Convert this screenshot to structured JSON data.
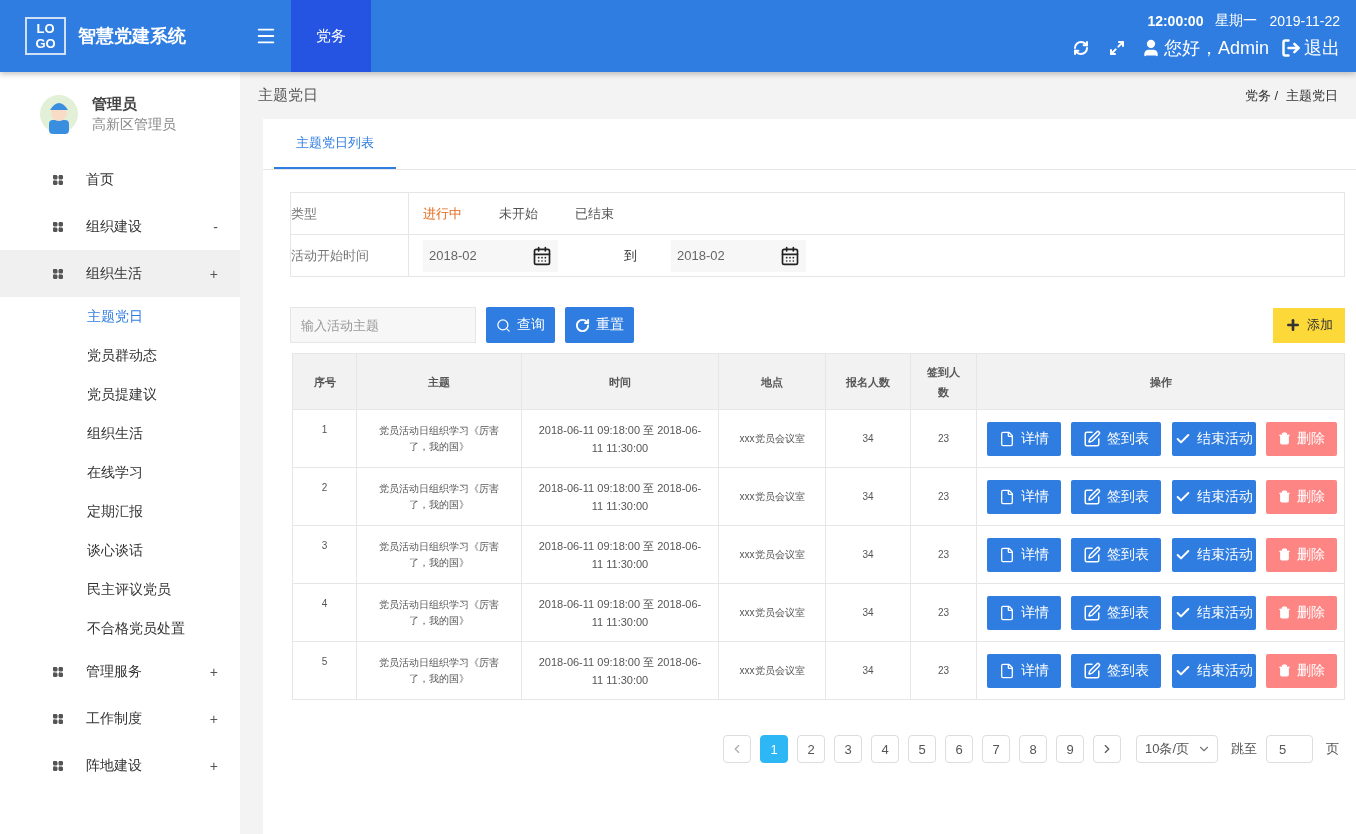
{
  "header": {
    "logo": [
      "LO",
      "GO"
    ],
    "title": "智慧党建系统",
    "nav": [
      {
        "label": "党务",
        "selected": true
      }
    ],
    "time": "12:00:00",
    "weekday": "星期一",
    "date": "2019-11-22",
    "greeting": "您好，Admin",
    "logout": "退出"
  },
  "user": {
    "name": "管理员",
    "role": "高新区管理员"
  },
  "sidebar": {
    "items": [
      {
        "label": "首页",
        "selected": false
      },
      {
        "label": "组织建设",
        "toggle": "-",
        "selected": false
      },
      {
        "label": "组织生活",
        "toggle": "+",
        "selected": true,
        "children": [
          {
            "label": "主题党日",
            "selected": true
          },
          {
            "label": "党员群动态",
            "selected": false
          },
          {
            "label": "党员提建议",
            "selected": false
          },
          {
            "label": "组织生活",
            "selected": false
          },
          {
            "label": "在线学习",
            "selected": false
          },
          {
            "label": "定期汇报",
            "selected": false
          },
          {
            "label": "谈心谈话",
            "selected": false
          },
          {
            "label": "民主评议党员",
            "selected": false
          },
          {
            "label": "不合格党员处置",
            "selected": false
          }
        ]
      },
      {
        "label": "管理服务",
        "toggle": "+",
        "selected": false
      },
      {
        "label": "工作制度",
        "toggle": "+",
        "selected": false
      },
      {
        "label": "阵地建设",
        "toggle": "+",
        "selected": false
      }
    ]
  },
  "page_title": "主题党日",
  "breadcrumb": [
    "党务 /",
    "主题党日"
  ],
  "tabs": [
    {
      "label": "主题党日列表",
      "selected": true
    }
  ],
  "filters": {
    "type_label": "类型",
    "types": [
      {
        "label": "进行中",
        "selected": true
      },
      {
        "label": "未开始",
        "selected": false
      },
      {
        "label": "已结束",
        "selected": false
      }
    ],
    "time_label": "活动开始时间",
    "start": "2018-02",
    "to": "到",
    "end": "2018-02"
  },
  "search": {
    "placeholder": "输入活动主题",
    "query": "查询",
    "reset": "重置",
    "add": "添加"
  },
  "table": {
    "columns": [
      "序号",
      "主题",
      "时间",
      "地点",
      "报名人数",
      "签到人数",
      "操作"
    ],
    "rows": [
      {
        "index": "1",
        "topic": "党员活动日组织学习《厉害了，我的国》",
        "time": "2018-06-11 09:18:00 至 2018-06-11 11:30:00",
        "place": "xxx党员会议室",
        "signup": "34",
        "checkin": "23",
        "actions": [
          {
            "kind": "detail",
            "label": "详情"
          },
          {
            "kind": "sheet",
            "label": "签到表"
          },
          {
            "kind": "end",
            "label": "结束活动"
          },
          {
            "kind": "delete",
            "label": "删除"
          }
        ]
      },
      {
        "index": "2",
        "topic": "党员活动日组织学习《厉害了，我的国》",
        "time": "2018-06-11 09:18:00 至 2018-06-11 11:30:00",
        "place": "xxx党员会议室",
        "signup": "34",
        "checkin": "23",
        "actions": [
          {
            "kind": "detail",
            "label": "详情"
          },
          {
            "kind": "sheet",
            "label": "签到表"
          },
          {
            "kind": "end",
            "label": "结束活动"
          },
          {
            "kind": "delete",
            "label": "删除"
          }
        ]
      },
      {
        "index": "3",
        "topic": "党员活动日组织学习《厉害了，我的国》",
        "time": "2018-06-11 09:18:00 至 2018-06-11 11:30:00",
        "place": "xxx党员会议室",
        "signup": "34",
        "checkin": "23",
        "actions": [
          {
            "kind": "detail",
            "label": "详情"
          },
          {
            "kind": "sheet",
            "label": "签到表"
          },
          {
            "kind": "end",
            "label": "结束活动"
          },
          {
            "kind": "delete",
            "label": "删除"
          }
        ]
      },
      {
        "index": "4",
        "topic": "党员活动日组织学习《厉害了，我的国》",
        "time": "2018-06-11 09:18:00 至 2018-06-11 11:30:00",
        "place": "xxx党员会议室",
        "signup": "34",
        "checkin": "23",
        "actions": [
          {
            "kind": "detail",
            "label": "详情"
          },
          {
            "kind": "sheet",
            "label": "签到表"
          },
          {
            "kind": "end",
            "label": "结束活动"
          },
          {
            "kind": "delete",
            "label": "删除"
          }
        ]
      },
      {
        "index": "5",
        "topic": "党员活动日组织学习《厉害了，我的国》",
        "time": "2018-06-11 09:18:00 至 2018-06-11 11:30:00",
        "place": "xxx党员会议室",
        "signup": "34",
        "checkin": "23",
        "actions": [
          {
            "kind": "detail",
            "label": "详情"
          },
          {
            "kind": "sheet",
            "label": "签到表"
          },
          {
            "kind": "end",
            "label": "结束活动"
          },
          {
            "kind": "delete",
            "label": "删除"
          }
        ]
      }
    ]
  },
  "pagination": {
    "pages": [
      {
        "label": "1",
        "selected": true
      },
      {
        "label": "2",
        "selected": false
      },
      {
        "label": "3",
        "selected": false
      },
      {
        "label": "4",
        "selected": false
      },
      {
        "label": "5",
        "selected": false
      },
      {
        "label": "6",
        "selected": false
      },
      {
        "label": "7",
        "selected": false
      },
      {
        "label": "8",
        "selected": false
      },
      {
        "label": "9",
        "selected": false
      }
    ],
    "page_size": "10条/页",
    "jump_label": "跳至",
    "jump_value": "5",
    "page_unit": "页"
  }
}
